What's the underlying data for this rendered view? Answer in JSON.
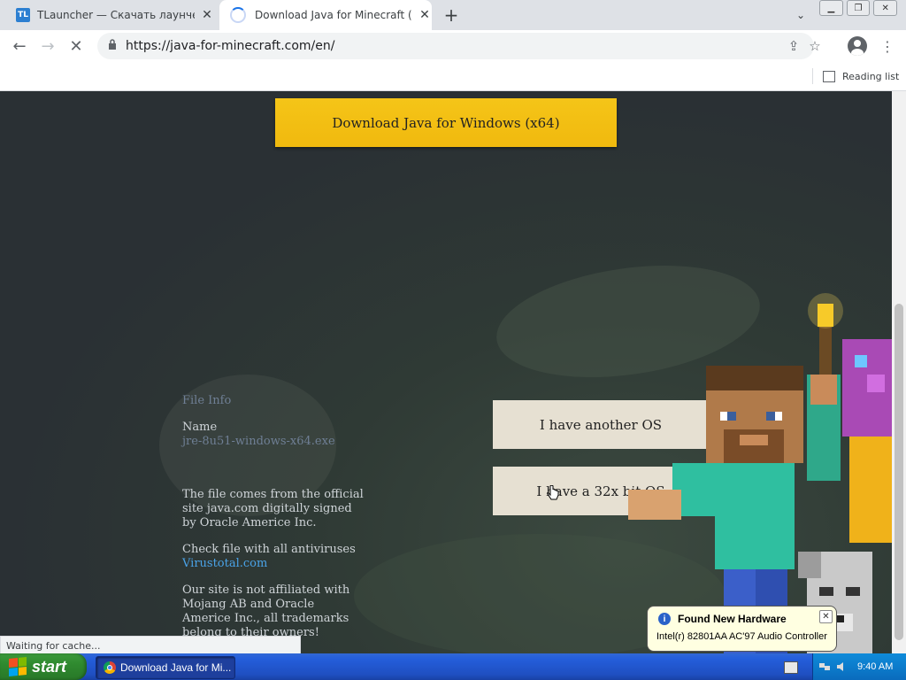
{
  "browser": {
    "tabs": [
      {
        "title": "TLauncher — Скачать лаунчер Ma",
        "favicon": "TL",
        "active": false
      },
      {
        "title": "Download Java for Minecraft (Recor",
        "active": true,
        "loading": true
      }
    ],
    "url": "https://java-for-minecraft.com/en/",
    "reading_list_label": "Reading list",
    "status_text": "Waiting for cache..."
  },
  "page": {
    "download_button": "Download Java for Windows (x64)",
    "other_os_button": "I have another OS",
    "bit32_button": "I have a 32x bit OS",
    "file_info": {
      "heading": "File Info",
      "name_label": "Name",
      "file_name": "jre-8u51-windows-x64.exe",
      "official_line1": "The file comes from the official",
      "official_line2": "site java.com digitally signed",
      "official_line3": "by Oracle Americe Inc.",
      "check_text": "Check file with all antiviruses",
      "virustotal_link": "Virustotal.com",
      "disclaimer_line1": "Our site is not affiliated with",
      "disclaimer_line2": "Mojang AB and Oracle",
      "disclaimer_line3": "Americe Inc., all trademarks",
      "disclaimer_line4": "belong to their owners!"
    }
  },
  "notification": {
    "title": "Found New Hardware",
    "text": "Intel(r) 82801AA AC'97 Audio Controller"
  },
  "taskbar": {
    "start_label": "start",
    "task_item": "Download Java for Mi...",
    "clock": "9:40 AM"
  },
  "colors": {
    "download_button": "#f5c518",
    "os_button": "#e6e0d2",
    "taskbar": "#245edb",
    "start_button": "#2f8a2f",
    "link": "#4aa3e8"
  }
}
